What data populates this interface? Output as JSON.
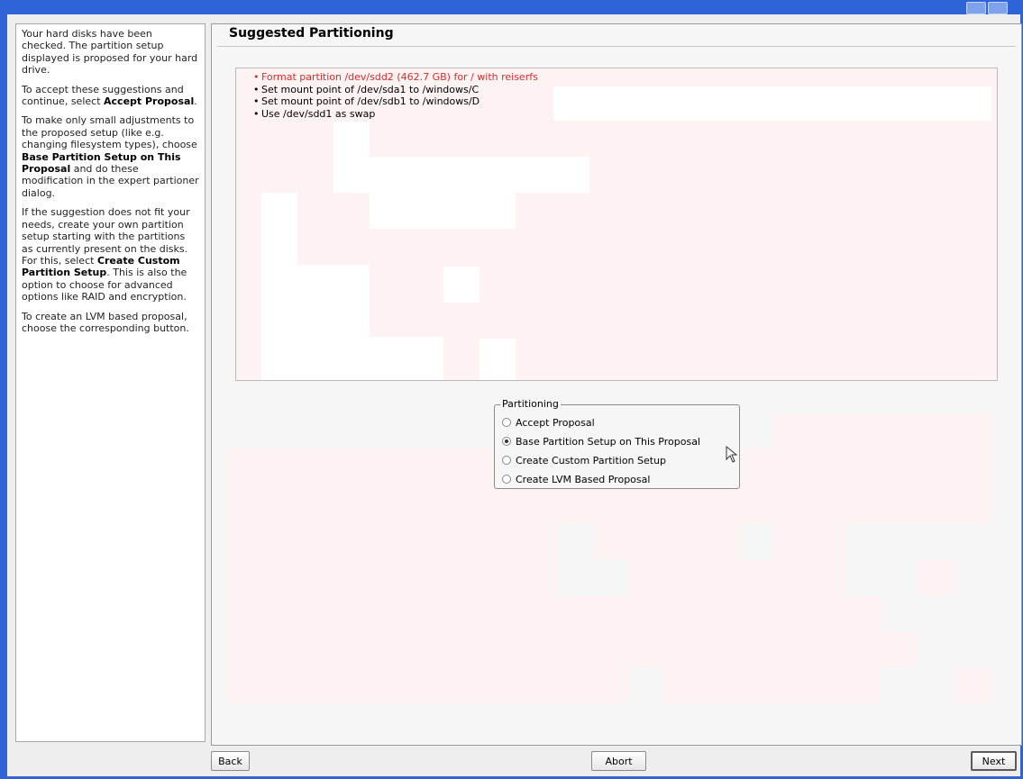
{
  "help": {
    "p1": "Your hard disks have been checked. The partition setup displayed is proposed for your hard drive.",
    "p2_pre": "To accept these suggestions and continue, select ",
    "p2_bold": "Accept Proposal",
    "p2_post": ".",
    "p3_pre": "To make only small adjustments to the proposed setup (like e.g. changing filesystem types), choose ",
    "p3_bold": "Base Partition Setup on This Proposal",
    "p3_post": " and do these modification in the expert partioner dialog.",
    "p4_pre": "If the suggestion does not fit your needs, create your own partition setup starting with the partitions as currently present on the disks. For this, select ",
    "p4_bold": "Create Custom Partition Setup",
    "p4_post": ". This is also the option to choose for advanced options like RAID and encryption.",
    "p5": "To create an LVM based proposal, choose the corresponding button."
  },
  "main": {
    "title": "Suggested Partitioning",
    "proposal_items": [
      "Format partition /dev/sdd2 (462.7 GB) for / with reiserfs",
      "Set mount point of /dev/sda1 to /windows/C",
      "Set mount point of /dev/sdb1 to /windows/D",
      "Use /dev/sdd1 as swap"
    ],
    "warning_color": "#e02828"
  },
  "partitioning": {
    "title": "Partitioning",
    "options": [
      {
        "label": "Accept Proposal",
        "selected": false
      },
      {
        "label": "Base Partition Setup on This Proposal",
        "selected": true
      },
      {
        "label": "Create Custom Partition Setup",
        "selected": false
      },
      {
        "label": "Create LVM Based Proposal",
        "selected": false
      }
    ]
  },
  "buttons": {
    "back": "Back",
    "abort": "Abort",
    "next": "Next"
  },
  "icons": {
    "cursor": "mouse-pointer-icon"
  }
}
